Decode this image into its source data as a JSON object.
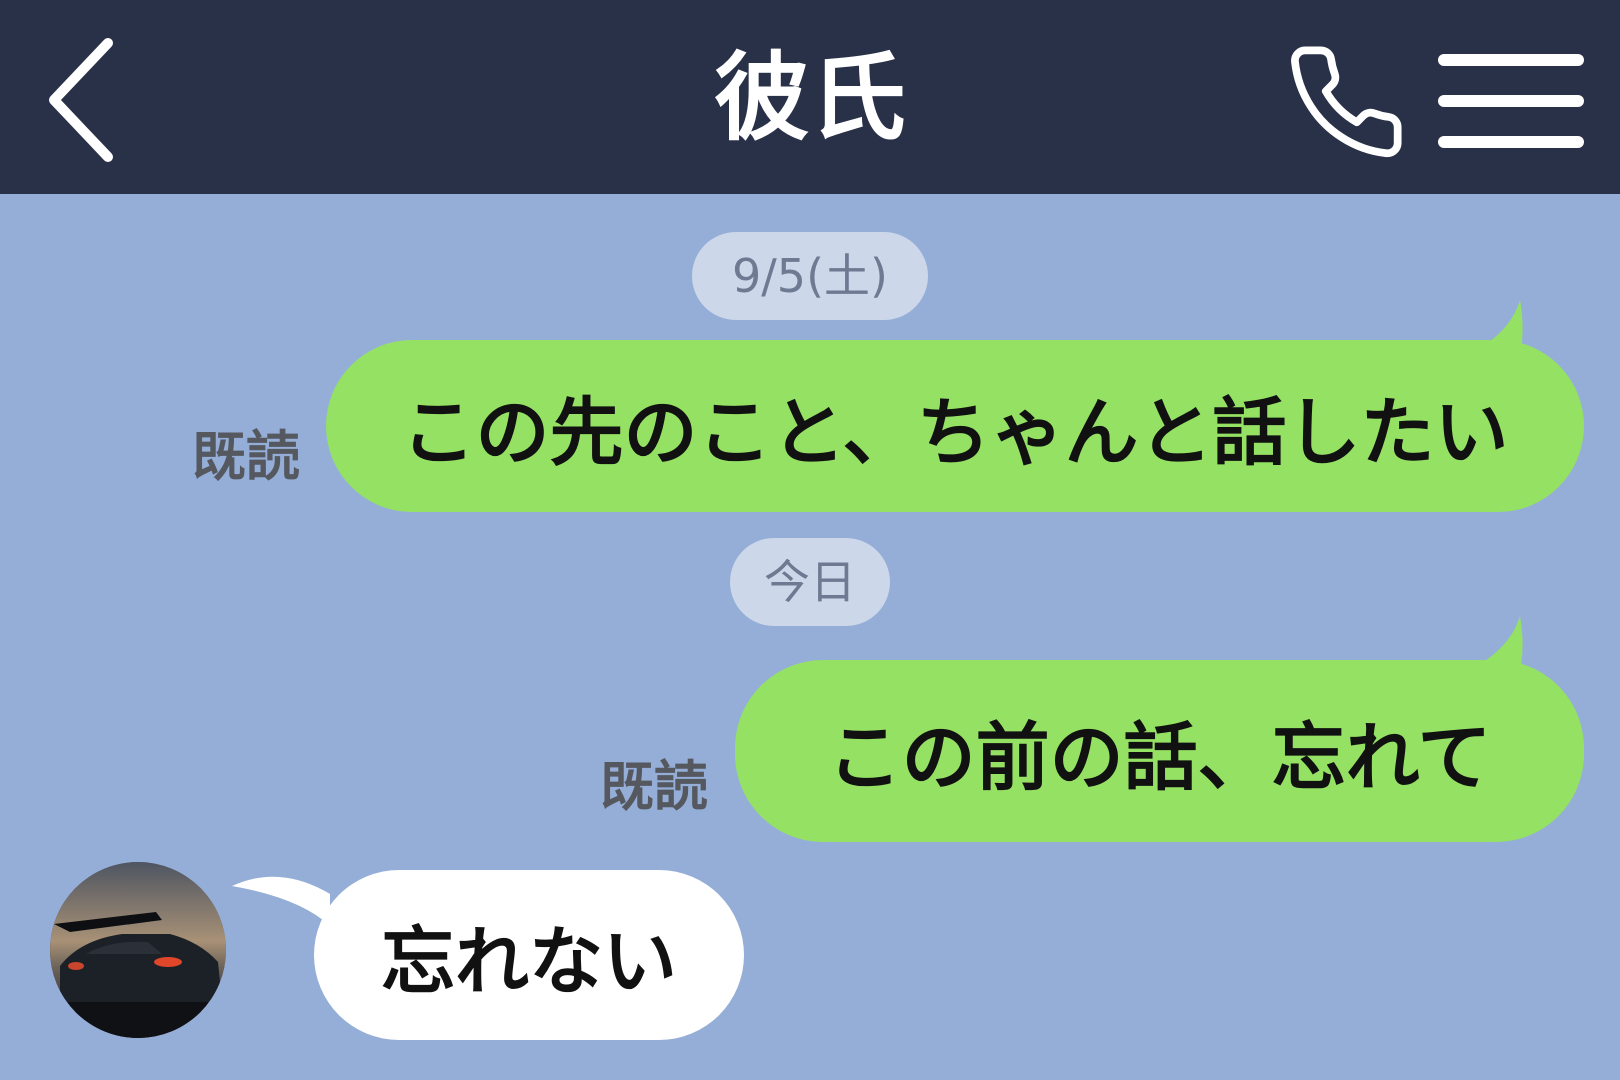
{
  "header": {
    "title": "彼氏",
    "back_icon": "chevron-left-icon",
    "call_icon": "phone-icon",
    "menu_icon": "hamburger-menu-icon"
  },
  "colors": {
    "header_bg": "#293148",
    "chat_bg": "#95aed7",
    "sent_bubble": "#95e164",
    "received_bubble": "#ffffff",
    "date_chip": "#ccd7ea"
  },
  "messages": [
    {
      "type": "date",
      "text": "9/5(土)"
    },
    {
      "type": "sent",
      "text": "この先のこと、ちゃんと話したい",
      "status": "既読"
    },
    {
      "type": "date",
      "text": "今日"
    },
    {
      "type": "sent",
      "text": "この前の話、忘れて",
      "status": "既読"
    },
    {
      "type": "received",
      "text": "忘れない",
      "avatar": "avatar-car-photo"
    }
  ]
}
